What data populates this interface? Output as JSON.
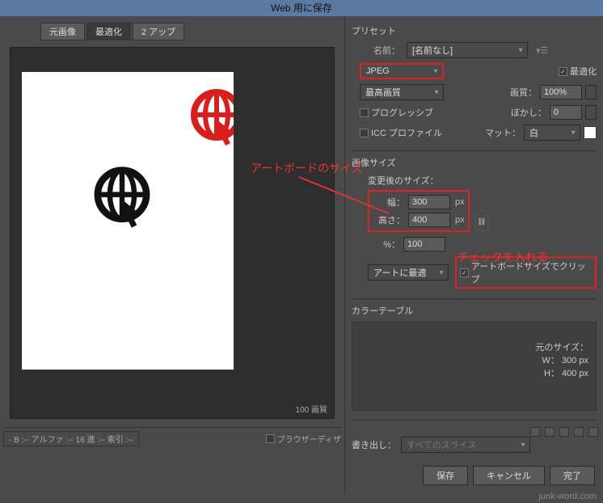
{
  "title": "Web 用に保存",
  "tabs": {
    "original": "元画像",
    "optimized": "最適化",
    "twoUp": "2 アップ"
  },
  "preview": {
    "footer": "100 画質"
  },
  "status": {
    "color": "- B :-- アルファ :-- 16 進 :-- 索引 :--",
    "browserDither": "ブラウザーディザ"
  },
  "preset": {
    "title": "プリセット",
    "name_label": "名前：",
    "name_value": "[名前なし]",
    "format": "JPEG",
    "quality_preset": "最高画質",
    "optimize_chk": "最適化",
    "quality_label": "画質：",
    "quality_value": "100%",
    "progressive": "プログレッシブ",
    "blur_label": "ぼかし：",
    "blur_value": "0",
    "icc": "ICC プロファイル",
    "matte_label": "マット：",
    "matte_value": "白"
  },
  "annotations": {
    "artboard_size": "アートボードのサイズ",
    "check_this": "チェックを入れる"
  },
  "image_size": {
    "title": "画像サイズ",
    "after_label": "変更後のサイズ：",
    "w_label": "幅：",
    "w_value": "300",
    "h_label": "高さ：",
    "h_value": "400",
    "unit": "px",
    "pct_label": "%：",
    "pct_value": "100",
    "fit_label": "アートに最適",
    "original_title": "元のサイズ：",
    "original_w": "W： 300 px",
    "original_h": "H： 400 px",
    "clip_chk": "アートボードサイズでクリップ"
  },
  "color_table": {
    "title": "カラーテーブル"
  },
  "export": {
    "label": "書き出し：",
    "value": "すべてのスライス"
  },
  "buttons": {
    "save": "保存",
    "cancel": "キャンセル",
    "done": "完了"
  },
  "watermark": "junk-word.com"
}
